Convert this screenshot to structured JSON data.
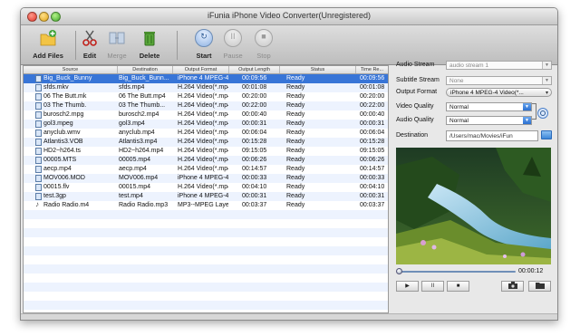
{
  "window": {
    "title": "iFunia iPhone Video Converter(Unregistered)"
  },
  "toolbar": {
    "add_files": "Add Files",
    "edit": "Edit",
    "merge": "Merge",
    "delete": "Delete",
    "start": "Start",
    "pause": "Pause",
    "stop": "Stop"
  },
  "table": {
    "headers": [
      "Source",
      "Destination",
      "Output Format",
      "Output Length",
      "Status",
      "Time Re..."
    ],
    "rows": [
      [
        "Big_Buck_Bunny",
        "Big_Buck_Bunn...",
        "iPhone 4 MPEG-4...",
        "00:09:56",
        "Ready",
        "00:09:56"
      ],
      [
        "sfds.mkv",
        "sfds.mp4",
        "H.264 Video(*.mp4)",
        "00:01:08",
        "Ready",
        "00:01:08"
      ],
      [
        "06 The Butt.mk",
        "06 The Butt.mp4",
        "H.264 Video(*.mp4)",
        "00:20:00",
        "Ready",
        "00:20:00"
      ],
      [
        "03 The Thumb.",
        "03 The Thumb...",
        "H.264 Video(*.mp4)",
        "00:22:00",
        "Ready",
        "00:22:00"
      ],
      [
        "burosch2.mpg",
        "burosch2.mp4",
        "H.264 Video(*.mp4)",
        "00:00:40",
        "Ready",
        "00:00:40"
      ],
      [
        "gol3.mpeg",
        "gol3.mp4",
        "H.264 Video(*.mp4)",
        "00:00:31",
        "Ready",
        "00:00:31"
      ],
      [
        "anyclub.wmv",
        "anyclub.mp4",
        "H.264 Video(*.mp4)",
        "00:06:04",
        "Ready",
        "00:06:04"
      ],
      [
        "Atlantis3.VOB",
        "Atlantis3.mp4",
        "H.264 Video(*.mp4)",
        "00:15:28",
        "Ready",
        "00:15:28"
      ],
      [
        "HD2~h264.ts",
        "HD2~h264.mp4",
        "H.264 Video(*.mp4)",
        "09:15:05",
        "Ready",
        "09:15:05"
      ],
      [
        "00005.MTS",
        "00005.mp4",
        "H.264 Video(*.mp4)",
        "00:06:26",
        "Ready",
        "00:06:26"
      ],
      [
        "aecp.mp4",
        "aecp.mp4",
        "H.264 Video(*.mp4)",
        "00:14:57",
        "Ready",
        "00:14:57"
      ],
      [
        "MOV006.MOD",
        "MOV006.mp4",
        "iPhone 4 MPEG-4...",
        "00:00:33",
        "Ready",
        "00:00:33"
      ],
      [
        "00015.flv",
        "00015.mp4",
        "H.264 Video(*.mp4)",
        "00:04:10",
        "Ready",
        "00:04:10"
      ],
      [
        "test.3gp",
        "test.mp4",
        "iPhone 4 MPEG-4...",
        "00:00:31",
        "Ready",
        "00:00:31"
      ],
      [
        "Radio Radio.m4",
        "Radio Radio.mp3",
        "MP3--MPEG Layer...",
        "00:03:37",
        "Ready",
        "00:03:37"
      ]
    ]
  },
  "panel": {
    "audio_stream_label": "Audio Stream",
    "audio_stream_value": "audio stream 1",
    "subtitle_stream_label": "Subtitle Stream",
    "subtitle_stream_value": "None",
    "output_format_label": "Output Format",
    "output_format_value": "iPhone 4 MPEG-4 Video(*...",
    "video_quality_label": "Video Quality",
    "video_quality_value": "Normal",
    "audio_quality_label": "Audio Quality",
    "audio_quality_value": "Normal",
    "destination_label": "Destination",
    "destination_value": "/Users/mac/Movies/iFun",
    "time": "00:00:12",
    "seek_fraction": 0.0
  },
  "controls": {
    "play": "▶",
    "pause": "II",
    "stop": "■"
  },
  "colors": {
    "selection": "#3875d7",
    "row_alt": "#edf3fe",
    "accent": "#2a6fd0"
  }
}
